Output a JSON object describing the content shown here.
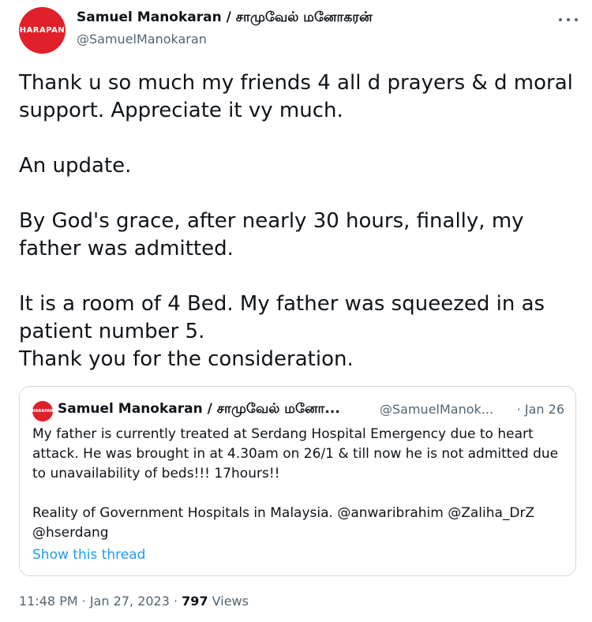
{
  "author": {
    "avatar_text": "HARAPAN",
    "name": "Samuel Manokaran / சாமுவேல் மனோகரன்",
    "handle": "@SamuelManokaran"
  },
  "tweet": {
    "text": "Thank u so much my friends 4 all d prayers & d moral\nsupport. Appreciate it vy much.\n\nAn update.\n\nBy God's grace, after nearly 30 hours, finally, my\nfather was admitted.\n\nIt is a room of 4 Bed. My father was squeezed in as\npatient number 5.\nThank you for the consideration."
  },
  "quote": {
    "avatar_text": "HARAPAN",
    "name": "Samuel Manokaran / சாமுவேல் மனோ...",
    "handle": "@SamuelManok...",
    "date": "· Jan 26",
    "text": "My father is currently treated at Serdang Hospital Emergency due to heart\nattack. He was brought in at 4.30am on 26/1 & till now he is not admitted due\nto unavailability of beds!!! 17hours!!\n\nReality of Government Hospitals in Malaysia. @anwaribrahim @Zaliha_DrZ\n@hserdang",
    "show_thread": "Show this thread"
  },
  "footer": {
    "time": "11:48 PM · Jan 27, 2023 · ",
    "views_count": "797",
    "views_label": " Views"
  }
}
